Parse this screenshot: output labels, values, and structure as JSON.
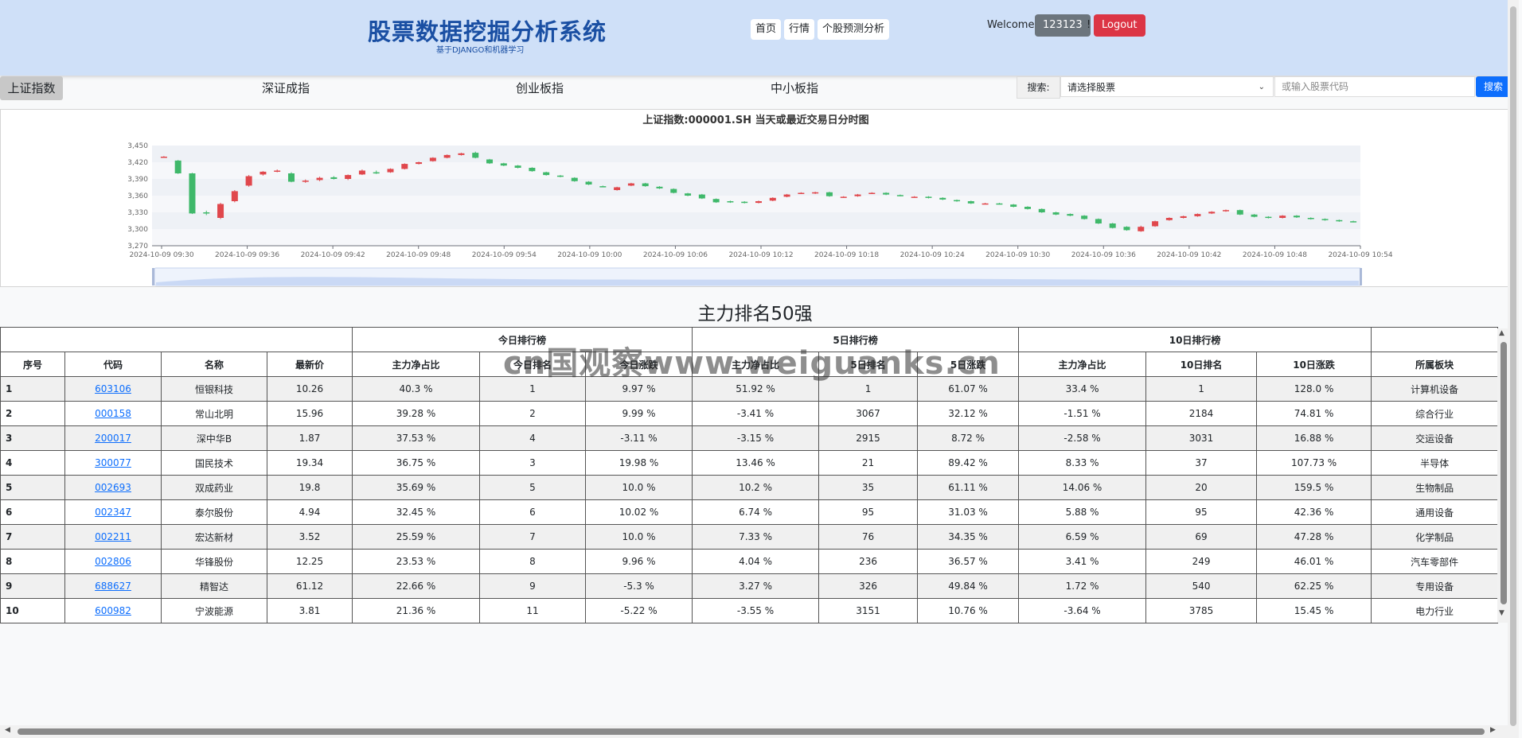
{
  "header": {
    "title": "股票数据挖掘分析系统",
    "subtitle": "基于DJANGO和机器学习",
    "nav": [
      "首页",
      "行情",
      "个股预测分析"
    ],
    "welcome": "Welcome,",
    "username": "123123",
    "exclaim": "!",
    "logout": "Logout"
  },
  "index_tabs": [
    "上证指数",
    "深证成指",
    "创业板指",
    "中小板指"
  ],
  "search": {
    "label": "搜索:",
    "select_value": "请选择股票",
    "input_placeholder": "或输入股票代码",
    "button": "搜索"
  },
  "chart_data": {
    "type": "candlestick",
    "title": "上证指数:000001.SH    当天或最近交易日分时图",
    "ylim": [
      3270,
      3450
    ],
    "yticks": [
      "3,270",
      "3,300",
      "3,330",
      "3,360",
      "3,390",
      "3,420",
      "3,450"
    ],
    "xticks": [
      "2024-10-09 09:30",
      "2024-10-09 09:36",
      "2024-10-09 09:42",
      "2024-10-09 09:48",
      "2024-10-09 09:54",
      "2024-10-09 10:00",
      "2024-10-09 10:06",
      "2024-10-09 10:12",
      "2024-10-09 10:18",
      "2024-10-09 10:24",
      "2024-10-09 10:30",
      "2024-10-09 10:36",
      "2024-10-09 10:42",
      "2024-10-09 10:48",
      "2024-10-09 10:54"
    ],
    "candles": [
      [
        3430,
        3430,
        3431,
        3429
      ],
      [
        3423,
        3400,
        3424,
        3399
      ],
      [
        3400,
        3328,
        3401,
        3327
      ],
      [
        3330,
        3328,
        3333,
        3325
      ],
      [
        3320,
        3345,
        3347,
        3318
      ],
      [
        3350,
        3368,
        3370,
        3348
      ],
      [
        3378,
        3395,
        3397,
        3376
      ],
      [
        3398,
        3403,
        3404,
        3396
      ],
      [
        3403,
        3405,
        3407,
        3402
      ],
      [
        3400,
        3385,
        3402,
        3384
      ],
      [
        3386,
        3387,
        3389,
        3383
      ],
      [
        3388,
        3392,
        3394,
        3386
      ],
      [
        3393,
        3390,
        3395,
        3389
      ],
      [
        3390,
        3397,
        3398,
        3388
      ],
      [
        3398,
        3405,
        3407,
        3397
      ],
      [
        3402,
        3400,
        3405,
        3399
      ],
      [
        3402,
        3408,
        3409,
        3401
      ],
      [
        3408,
        3417,
        3418,
        3407
      ],
      [
        3417,
        3420,
        3421,
        3416
      ],
      [
        3422,
        3428,
        3429,
        3421
      ],
      [
        3428,
        3433,
        3434,
        3427
      ],
      [
        3433,
        3436,
        3437,
        3432
      ],
      [
        3437,
        3428,
        3439,
        3427
      ],
      [
        3425,
        3418,
        3426,
        3417
      ],
      [
        3418,
        3414,
        3419,
        3413
      ],
      [
        3414,
        3410,
        3415,
        3409
      ],
      [
        3410,
        3404,
        3411,
        3403
      ],
      [
        3402,
        3397,
        3403,
        3396
      ],
      [
        3396,
        3394,
        3397,
        3393
      ],
      [
        3392,
        3386,
        3393,
        3385
      ],
      [
        3385,
        3380,
        3386,
        3379
      ],
      [
        3377,
        3376,
        3378,
        3375
      ],
      [
        3370,
        3375,
        3376,
        3369
      ],
      [
        3378,
        3382,
        3383,
        3377
      ],
      [
        3382,
        3377,
        3383,
        3376
      ],
      [
        3376,
        3373,
        3377,
        3372
      ],
      [
        3372,
        3365,
        3373,
        3364
      ],
      [
        3364,
        3360,
        3365,
        3359
      ],
      [
        3362,
        3355,
        3363,
        3354
      ],
      [
        3354,
        3348,
        3355,
        3347
      ],
      [
        3350,
        3348,
        3351,
        3347
      ],
      [
        3349,
        3347,
        3350,
        3346
      ],
      [
        3347,
        3350,
        3351,
        3346
      ],
      [
        3351,
        3356,
        3357,
        3350
      ],
      [
        3358,
        3362,
        3363,
        3357
      ],
      [
        3364,
        3365,
        3366,
        3363
      ],
      [
        3364,
        3366,
        3367,
        3363
      ],
      [
        3366,
        3359,
        3367,
        3358
      ],
      [
        3358,
        3358,
        3359,
        3357
      ],
      [
        3359,
        3362,
        3363,
        3358
      ],
      [
        3364,
        3365,
        3366,
        3363
      ],
      [
        3365,
        3362,
        3366,
        3361
      ],
      [
        3361,
        3360,
        3362,
        3359
      ],
      [
        3358,
        3358,
        3359,
        3357
      ],
      [
        3358,
        3356,
        3359,
        3355
      ],
      [
        3356,
        3353,
        3357,
        3352
      ],
      [
        3352,
        3350,
        3353,
        3349
      ],
      [
        3350,
        3346,
        3351,
        3345
      ],
      [
        3346,
        3346,
        3347,
        3345
      ],
      [
        3346,
        3345,
        3347,
        3344
      ],
      [
        3344,
        3340,
        3345,
        3339
      ],
      [
        3340,
        3336,
        3341,
        3335
      ],
      [
        3336,
        3330,
        3337,
        3329
      ],
      [
        3330,
        3326,
        3331,
        3325
      ],
      [
        3327,
        3324,
        3328,
        3323
      ],
      [
        3324,
        3318,
        3325,
        3317
      ],
      [
        3318,
        3310,
        3319,
        3309
      ],
      [
        3310,
        3302,
        3311,
        3301
      ],
      [
        3304,
        3298,
        3305,
        3297
      ],
      [
        3296,
        3304,
        3306,
        3295
      ],
      [
        3305,
        3314,
        3315,
        3304
      ],
      [
        3316,
        3320,
        3321,
        3315
      ],
      [
        3320,
        3323,
        3324,
        3319
      ],
      [
        3323,
        3327,
        3328,
        3322
      ],
      [
        3328,
        3331,
        3332,
        3327
      ],
      [
        3332,
        3334,
        3335,
        3331
      ],
      [
        3334,
        3326,
        3335,
        3325
      ],
      [
        3326,
        3322,
        3327,
        3321
      ],
      [
        3322,
        3320,
        3323,
        3319
      ],
      [
        3320,
        3324,
        3325,
        3319
      ],
      [
        3324,
        3321,
        3325,
        3320
      ],
      [
        3320,
        3318,
        3321,
        3317
      ],
      [
        3318,
        3316,
        3319,
        3315
      ],
      [
        3316,
        3314,
        3317,
        3313
      ],
      [
        3314,
        3313,
        3315,
        3312
      ]
    ]
  },
  "ranking": {
    "title": "主力排名50强",
    "group_headers": [
      "今日排行榜",
      "5日排行榜",
      "10日排行榜"
    ],
    "columns": [
      "序号",
      "代码",
      "名称",
      "最新价",
      "主力净占比",
      "今日排名",
      "今日涨跌",
      "主力净占比",
      "5日排名",
      "5日涨跌",
      "主力净占比",
      "10日排名",
      "10日涨跌",
      "所属板块"
    ],
    "rows": [
      [
        "1",
        "603106",
        "恒银科技",
        "10.26",
        "40.3 %",
        "1",
        "9.97 %",
        "51.92 %",
        "1",
        "61.07 %",
        "33.4 %",
        "1",
        "128.0 %",
        "计算机设备"
      ],
      [
        "2",
        "000158",
        "常山北明",
        "15.96",
        "39.28 %",
        "2",
        "9.99 %",
        "-3.41 %",
        "3067",
        "32.12 %",
        "-1.51 %",
        "2184",
        "74.81 %",
        "综合行业"
      ],
      [
        "3",
        "200017",
        "深中华B",
        "1.87",
        "37.53 %",
        "4",
        "-3.11 %",
        "-3.15 %",
        "2915",
        "8.72 %",
        "-2.58 %",
        "3031",
        "16.88 %",
        "交运设备"
      ],
      [
        "4",
        "300077",
        "国民技术",
        "19.34",
        "36.75 %",
        "3",
        "19.98 %",
        "13.46 %",
        "21",
        "89.42 %",
        "8.33 %",
        "37",
        "107.73 %",
        "半导体"
      ],
      [
        "5",
        "002693",
        "双成药业",
        "19.8",
        "35.69 %",
        "5",
        "10.0 %",
        "10.2 %",
        "35",
        "61.11 %",
        "14.06 %",
        "20",
        "159.5 %",
        "生物制品"
      ],
      [
        "6",
        "002347",
        "泰尔股份",
        "4.94",
        "32.45 %",
        "6",
        "10.02 %",
        "6.74 %",
        "95",
        "31.03 %",
        "5.88 %",
        "95",
        "42.36 %",
        "通用设备"
      ],
      [
        "7",
        "002211",
        "宏达新材",
        "3.52",
        "25.59 %",
        "7",
        "10.0 %",
        "7.33 %",
        "76",
        "34.35 %",
        "6.59 %",
        "69",
        "47.28 %",
        "化学制品"
      ],
      [
        "8",
        "002806",
        "华锋股份",
        "12.25",
        "23.53 %",
        "8",
        "9.96 %",
        "4.04 %",
        "236",
        "36.57 %",
        "3.41 %",
        "249",
        "46.01 %",
        "汽车零部件"
      ],
      [
        "9",
        "688627",
        "精智达",
        "61.12",
        "22.66 %",
        "9",
        "-5.3 %",
        "3.27 %",
        "326",
        "49.84 %",
        "1.72 %",
        "540",
        "62.25 %",
        "专用设备"
      ],
      [
        "10",
        "600982",
        "宁波能源",
        "3.81",
        "21.36 %",
        "11",
        "-5.22 %",
        "-3.55 %",
        "3151",
        "10.76 %",
        "-3.64 %",
        "3785",
        "15.45 %",
        "电力行业"
      ]
    ]
  },
  "watermark": "cn国观察www.weiguanks.cn",
  "colors": {
    "up": "#e0474c",
    "down": "#3fb86a",
    "header_bg": "#cfe0f8",
    "brand": "#1a4fa3"
  }
}
